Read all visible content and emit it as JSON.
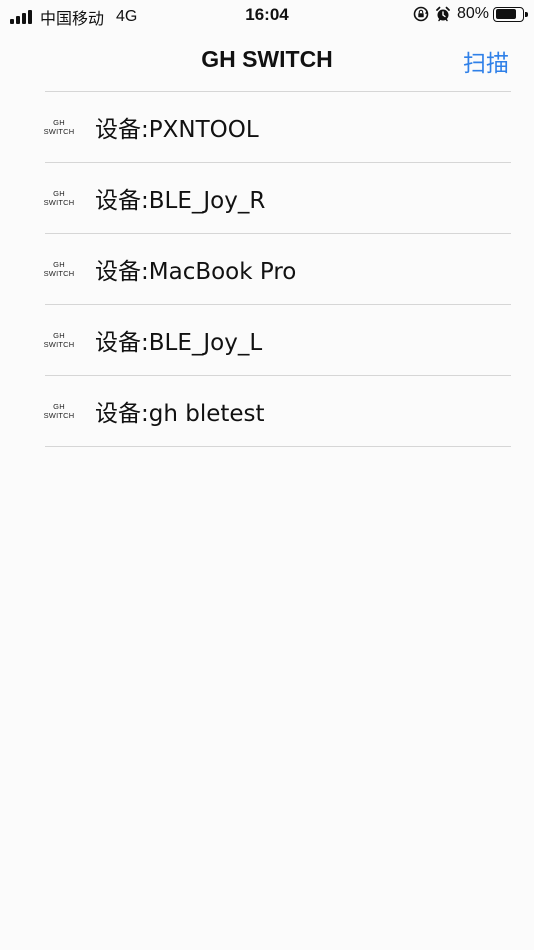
{
  "status_bar": {
    "carrier": "中国移动",
    "network": "4G",
    "time": "16:04",
    "battery_percent": "80%",
    "battery_level": 0.8,
    "icons": [
      "signal-icon",
      "rotation-lock-icon",
      "alarm-icon",
      "battery-icon"
    ]
  },
  "nav": {
    "title": "GH SWITCH",
    "action_label": "扫描",
    "accent_color": "#2f80e8"
  },
  "device_logo": {
    "line1": "GH",
    "line2": "SWITCH"
  },
  "devices": [
    {
      "label": "设备:PXNTOOL"
    },
    {
      "label": "设备:BLE_Joy_R"
    },
    {
      "label": "设备:MacBook Pro"
    },
    {
      "label": "设备:BLE_Joy_L"
    },
    {
      "label": "设备:gh bletest"
    }
  ]
}
